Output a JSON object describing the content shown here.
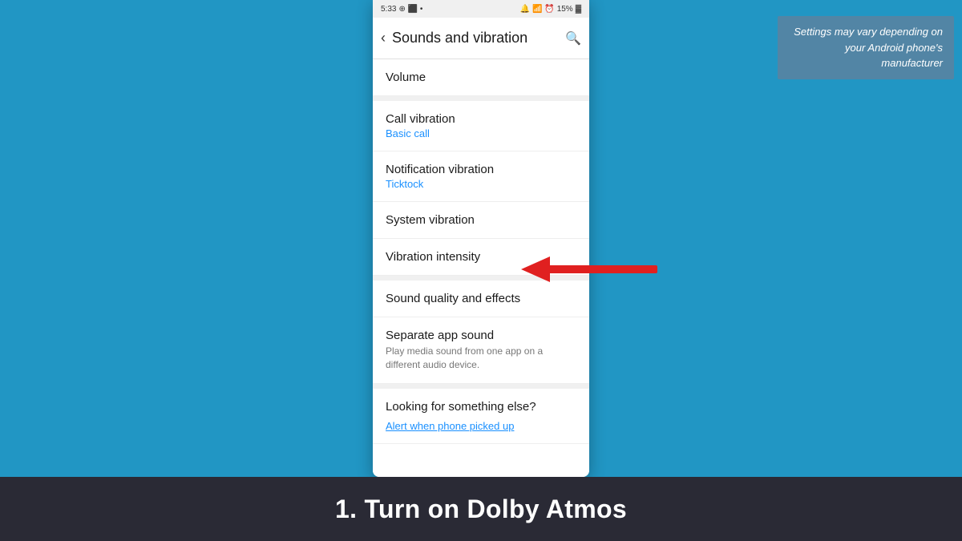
{
  "background": {
    "color": "#2196C4"
  },
  "disclaimer": {
    "text": "Settings may vary depending on your Android phone's manufacturer"
  },
  "bottom_bar": {
    "text": "1. Turn on Dolby Atmos"
  },
  "status_bar": {
    "time": "5:33",
    "battery": "15%",
    "icons": "🔔 📶 🔋"
  },
  "header": {
    "title": "Sounds and vibration",
    "back_label": "‹",
    "search_icon": "🔍"
  },
  "settings_items": [
    {
      "id": "volume",
      "title": "Volume",
      "subtitle": "",
      "desc": ""
    },
    {
      "id": "call-vibration",
      "title": "Call vibration",
      "subtitle": "Basic call",
      "desc": ""
    },
    {
      "id": "notification-vibration",
      "title": "Notification vibration",
      "subtitle": "Ticktock",
      "desc": ""
    },
    {
      "id": "system-vibration",
      "title": "System vibration",
      "subtitle": "",
      "desc": ""
    },
    {
      "id": "vibration-intensity",
      "title": "Vibration intensity",
      "subtitle": "",
      "desc": ""
    },
    {
      "id": "sound-quality",
      "title": "Sound quality and effects",
      "subtitle": "",
      "desc": ""
    },
    {
      "id": "separate-app-sound",
      "title": "Separate app sound",
      "subtitle": "",
      "desc": "Play media sound from one app on a different audio device."
    }
  ],
  "looking_section": {
    "title": "Looking for something else?",
    "link_text": "Alert when phone picked up"
  },
  "arrow": {
    "color": "#e02020"
  }
}
